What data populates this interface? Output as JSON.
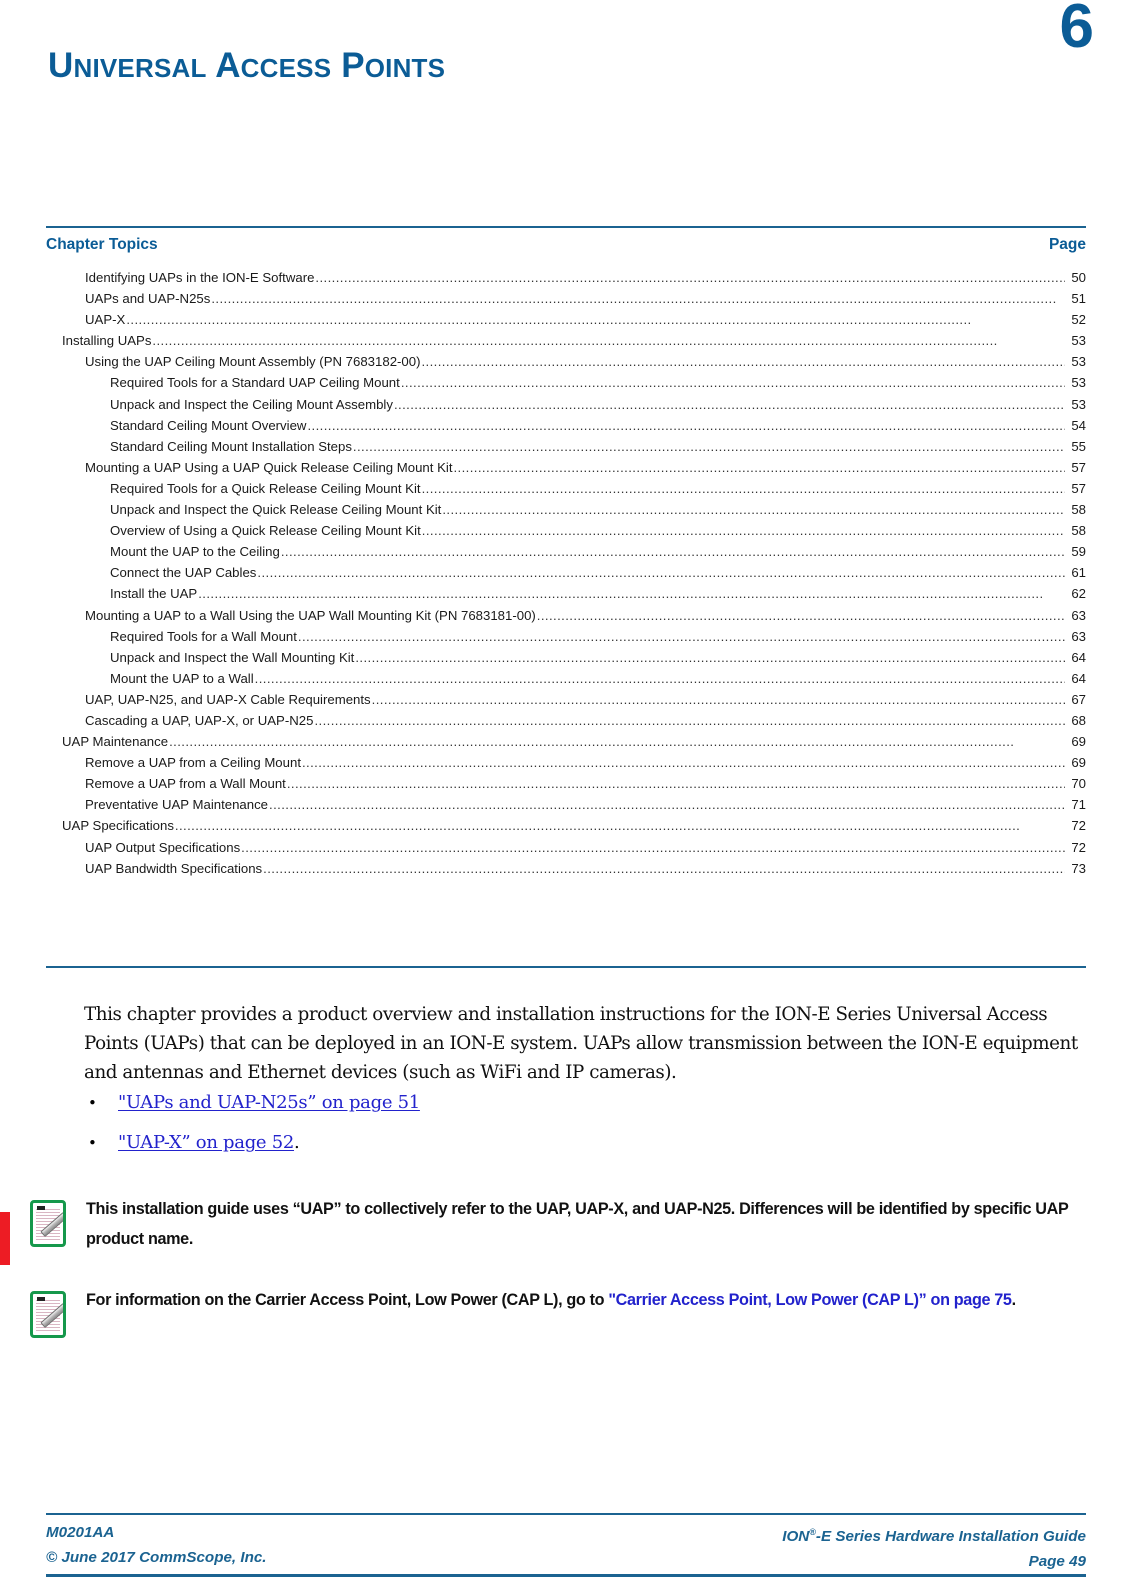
{
  "chapter": {
    "number": "6",
    "title_primary": "U",
    "title": "UNIVERSAL ACCESS POINTS",
    "title_parts": [
      {
        "cap": "U",
        "rest": "NIVERSAL"
      },
      {
        "cap": "A",
        "rest": "CCESS"
      },
      {
        "cap": "P",
        "rest": "OINTS"
      }
    ]
  },
  "toc": {
    "heading": "Chapter Topics",
    "page_heading": "Page",
    "dots": "................................................................................................................................................................................................................",
    "entries": [
      {
        "label": "Identifying UAPs in the ION-E Software",
        "page": "50",
        "level": 2
      },
      {
        "label": "UAPs and UAP-N25s",
        "page": "51",
        "level": 2
      },
      {
        "label": "UAP-X",
        "page": "52",
        "level": 2
      },
      {
        "label": "Installing UAPs",
        "page": "53",
        "level": 1
      },
      {
        "label": "Using the UAP Ceiling Mount Assembly (PN 7683182-00)",
        "page": "53",
        "level": 2
      },
      {
        "label": "Required Tools for a Standard UAP Ceiling Mount",
        "page": "53",
        "level": 3
      },
      {
        "label": "Unpack and Inspect the Ceiling Mount Assembly",
        "page": "53",
        "level": 3
      },
      {
        "label": "Standard Ceiling Mount Overview",
        "page": "54",
        "level": 3
      },
      {
        "label": "Standard Ceiling Mount Installation Steps",
        "page": "55",
        "level": 3
      },
      {
        "label": "Mounting a UAP Using a UAP Quick Release Ceiling Mount Kit",
        "page": "57",
        "level": 2
      },
      {
        "label": "Required Tools for a Quick Release Ceiling Mount Kit",
        "page": "57",
        "level": 3
      },
      {
        "label": "Unpack and Inspect the Quick Release Ceiling Mount Kit",
        "page": "58",
        "level": 3
      },
      {
        "label": "Overview of Using a Quick Release Ceiling Mount Kit",
        "page": "58",
        "level": 3
      },
      {
        "label": "Mount the UAP to the Ceiling",
        "page": "59",
        "level": 3
      },
      {
        "label": "Connect the UAP Cables",
        "page": "61",
        "level": 3
      },
      {
        "label": "Install the UAP",
        "page": "62",
        "level": 3
      },
      {
        "label": "Mounting a UAP to a Wall Using the UAP Wall Mounting Kit (PN 7683181-00)",
        "page": "63",
        "level": 2
      },
      {
        "label": "Required Tools for a Wall Mount",
        "page": "63",
        "level": 3
      },
      {
        "label": "Unpack and Inspect the Wall Mounting Kit",
        "page": "64",
        "level": 3
      },
      {
        "label": "Mount the UAP to a Wall",
        "page": "64",
        "level": 3
      },
      {
        "label": "UAP, UAP-N25, and UAP-X Cable Requirements",
        "page": "67",
        "level": 2
      },
      {
        "label": "Cascading a UAP, UAP-X, or UAP-N25",
        "page": "68",
        "level": 2
      },
      {
        "label": "UAP Maintenance",
        "page": "69",
        "level": 1
      },
      {
        "label": "Remove a UAP from a Ceiling Mount",
        "page": "69",
        "level": 2
      },
      {
        "label": "Remove a UAP from a Wall Mount",
        "page": "70",
        "level": 2
      },
      {
        "label": "Preventative UAP Maintenance",
        "page": "71",
        "level": 2
      },
      {
        "label": "UAP Specifications",
        "page": "72",
        "level": 1
      },
      {
        "label": "UAP Output Specifications",
        "page": "72",
        "level": 2
      },
      {
        "label": "UAP Bandwidth Specifications",
        "page": "73",
        "level": 2
      }
    ]
  },
  "intro": {
    "paragraph": "This chapter provides a product overview and installation instructions for the ION-E Series Universal Access Points (UAPs) that can be deployed in an ION-E system. UAPs allow transmission between the ION-E equipment and antennas and Ethernet devices (such as WiFi and IP cameras)."
  },
  "bullets": [
    {
      "marker": "•",
      "link": "\"UAPs and UAP-N25s” on page 51",
      "trailing": ""
    },
    {
      "marker": "•",
      "link": "\"UAP-X” on page 52",
      "trailing": "."
    }
  ],
  "notes": [
    {
      "icon": "note-pencil-icon",
      "text": "This installation guide uses “UAP” to collectively refer to the UAP, UAP-X, and UAP-N25. Differences will be identified by specific UAP product name.",
      "link": "",
      "trailing": ""
    },
    {
      "icon": "note-pencil-icon",
      "text": "For information on the Carrier Access Point, Low Power (CAP L), go to ",
      "link": "\"Carrier Access Point, Low Power (CAP L)” on page 75",
      "trailing": "."
    }
  ],
  "footer": {
    "doc_number": "M0201AA",
    "copyright": "© June 2017 CommScope, Inc.",
    "guide_pre": "ION",
    "guide_sup": "®",
    "guide_post": "-E Series Hardware Installation Guide",
    "page_label": "Page 49"
  },
  "colors": {
    "brand_blue": "#0B5C96",
    "rule_blue": "#1B6391",
    "link_blue": "#2222CC",
    "note_green": "#15984B",
    "change_bar_red": "#ED1C24"
  }
}
